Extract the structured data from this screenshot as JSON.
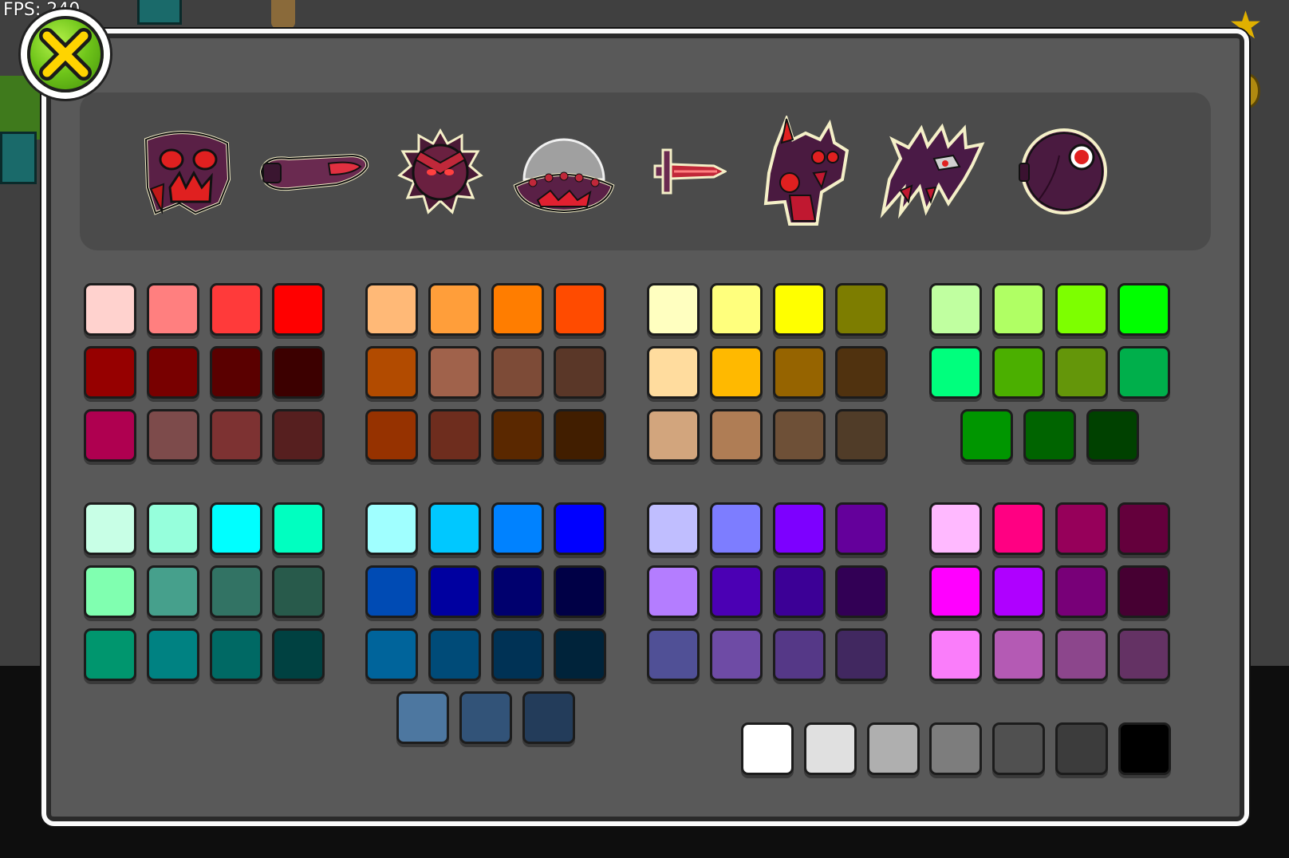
{
  "hud": {
    "fps_text": "FPS: 240"
  },
  "icons": [
    {
      "name": "demon-skull-icon",
      "label": "demon-skull"
    },
    {
      "name": "tentacle-ship-icon",
      "label": "tentacle-ship"
    },
    {
      "name": "spiked-ball-icon",
      "label": "spiked-ball"
    },
    {
      "name": "ufo-icon",
      "label": "ufo"
    },
    {
      "name": "sword-wave-icon",
      "label": "sword-wave"
    },
    {
      "name": "demon-robot-icon",
      "label": "demon-robot"
    },
    {
      "name": "spiked-spider-icon",
      "label": "spiked-spider"
    },
    {
      "name": "eye-swing-icon",
      "label": "eye-swing"
    }
  ],
  "palette": {
    "groups": [
      {
        "name": "reds",
        "rows": [
          [
            "#FFD2CE",
            "#FF7F7F",
            "#FF3A3A",
            "#FF0000"
          ],
          [
            "#960000",
            "#780000",
            "#5A0000",
            "#3C0000"
          ],
          [
            "#AF0050",
            "#7D4B4B",
            "#7D3232",
            "#561F1F"
          ]
        ]
      },
      {
        "name": "oranges",
        "rows": [
          [
            "#FFB977",
            "#FF9E3A",
            "#FF7D00",
            "#FF4B00"
          ],
          [
            "#B24B00",
            "#A0624B",
            "#7D4B37",
            "#5A3728"
          ],
          [
            "#963200",
            "#6E2D1E",
            "#5A2800",
            "#411E00"
          ]
        ]
      },
      {
        "name": "yellows",
        "rows": [
          [
            "#FFFFC0",
            "#FFFF7D",
            "#FFFF00",
            "#7D7D00"
          ],
          [
            "#FFDC9E",
            "#FFB900",
            "#966400",
            "#50320F"
          ],
          [
            "#D2A57D",
            "#AF7D55",
            "#6E5037",
            "#503C28"
          ]
        ]
      },
      {
        "name": "greens",
        "rows": [
          [
            "#C0FFA0",
            "#B0FF64",
            "#7DFF00",
            "#00FF00"
          ],
          [
            "#00FF7D",
            "#4BAF00",
            "#64960A",
            "#00AF4B"
          ],
          [
            "#009600",
            "#006400",
            "#004100"
          ]
        ]
      },
      {
        "name": "cyans",
        "rows": [
          [
            "#C8FFE6",
            "#96FFDC",
            "#00FFFF",
            "#00FFC0"
          ],
          [
            "#80FFB0",
            "#46A08C",
            "#327364",
            "#285A4B"
          ],
          [
            "#00966E",
            "#008282",
            "#006964",
            "#004141"
          ]
        ]
      },
      {
        "name": "blues",
        "rows": [
          [
            "#A0FFFF",
            "#00C8FF",
            "#0082FF",
            "#0000FF"
          ],
          [
            "#004BB4",
            "#0000A0",
            "#00006E",
            "#000046"
          ],
          [
            "#00649B",
            "#004B78",
            "#003255",
            "#00233A"
          ],
          [
            "#4D77A0",
            "#325378",
            "#233C5A"
          ]
        ]
      },
      {
        "name": "purples",
        "rows": [
          [
            "#C0BEFF",
            "#7D7DFF",
            "#7D00FF",
            "#64009B"
          ],
          [
            "#B47DFF",
            "#4B00B4",
            "#3C0096",
            "#320055"
          ],
          [
            "#505096",
            "#6E4BA5",
            "#553887",
            "#412860"
          ]
        ]
      },
      {
        "name": "pinks",
        "rows": [
          [
            "#FFB9FF",
            "#FF0082",
            "#96005A",
            "#64003C"
          ],
          [
            "#FF00FF",
            "#AF00FF",
            "#780078",
            "#460032"
          ],
          [
            "#FA7DFA",
            "#B45AB4",
            "#8C468C",
            "#643264"
          ]
        ]
      },
      {
        "name": "grays",
        "rows": [
          [
            "#FFFFFF",
            "#E0E0E0",
            "#AFAFAF",
            "#7D7D7D",
            "#505050",
            "#3C3C3C",
            "#000000"
          ]
        ]
      }
    ]
  }
}
